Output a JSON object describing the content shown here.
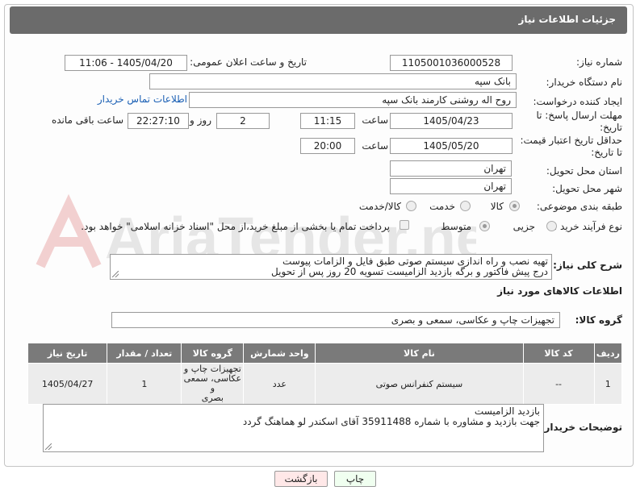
{
  "header": {
    "title": "جزئیات اطلاعات نیاز"
  },
  "form": {
    "need_number_label": "شماره نیاز:",
    "need_number": "1105001036000528",
    "announce_label": "تاریخ و ساعت اعلان عمومی:",
    "announce_value": "1405/04/20 - 11:06",
    "buyer_org_label": "نام دستگاه خریدار:",
    "buyer_org": "بانک سپه",
    "creator_label": "ایجاد کننده درخواست:",
    "creator": "روح اله روشنی کارمند بانک سپه",
    "contact_link": "اطلاعات تماس خریدار",
    "reply_deadline_label_1": "مهلت ارسال پاسخ: تا",
    "reply_deadline_label_2": "تاریخ:",
    "reply_date": "1405/04/23",
    "time_label": "ساعت",
    "reply_time": "11:15",
    "days_value": "2",
    "days_label": "روز و",
    "remaining_time": "22:27:10",
    "remaining_label": "ساعت باقی مانده",
    "min_valid_label_1": "حداقل تاریخ اعتبار قیمت:",
    "min_valid_label_2": "تا تاریخ:",
    "valid_date": "1405/05/20",
    "valid_time_label": "ساعت",
    "valid_time": "20:00",
    "province_label": "استان محل تحویل:",
    "province": "تهران",
    "city_label": "شهر محل تحویل:",
    "city": "تهران",
    "category_label": "طبقه بندی موضوعی:",
    "category_options": [
      "کالا",
      "خدمت",
      "کالا/خدمت"
    ],
    "process_label": "نوع فرآیند خرید :",
    "process_options": [
      "جزیی",
      "متوسط"
    ],
    "payment_note": "پرداخت تمام یا بخشی از مبلغ خرید،از محل \"اسناد خزانه اسلامی\" خواهد بود.",
    "description_label": "شرح کلی نیاز:",
    "description_line1": "تهیه نصب و راه اندازی سیستم صوتی طبق فایل و الزامات پیوست",
    "description_line2": "درج پیش فاکتور و برگه بازدید الزامیست تسویه 20 روز پس از تحویل"
  },
  "goods": {
    "section_title": "اطلاعات کالاهای مورد نیاز",
    "group_label": "گروه کالا:",
    "group_value": "تجهیزات چاپ و عکاسی، سمعی و بصری",
    "columns": [
      "ردیف",
      "کد کالا",
      "نام کالا",
      "واحد شمارش",
      "گروه کالا",
      "تعداد / مقدار",
      "تاریخ نیاز"
    ],
    "rows": [
      {
        "row": "1",
        "code": "--",
        "name": "سیستم کنفرانس صوتی",
        "unit": "عدد",
        "group_line1": "تجهیزات چاپ و",
        "group_line2": "عکاسی، سمعی و",
        "group_line3": "بصری",
        "qty": "1",
        "date": "1405/04/27"
      }
    ]
  },
  "buyer_notes": {
    "label": "توضیحات خریدار:",
    "line1": "بازدید الزامیست",
    "line2": "جهت بازدید و مشاوره با شماره 35911488 آقای اسکندر لو هماهنگ گردد"
  },
  "buttons": {
    "print": "چاپ",
    "back": "بازگشت"
  },
  "watermark": {
    "text": "AriaTender.net"
  },
  "colors": {
    "header_bg": "#6b6b6b",
    "table_header_bg": "#7a7a7a",
    "link": "#1a5fb4",
    "print_btn": "#f0fff0",
    "back_btn": "#ffe8e8"
  }
}
